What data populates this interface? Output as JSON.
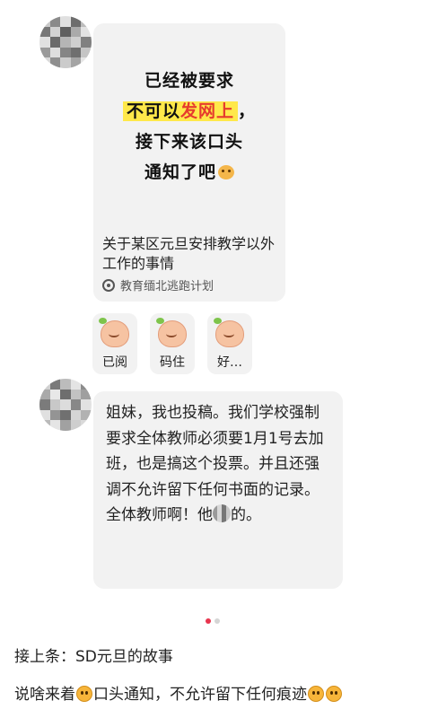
{
  "post_card": {
    "poster_lines": [
      "已经被要求",
      "不可以",
      "发网上",
      "，",
      "接下来该口头",
      "通知了吧"
    ],
    "title": "关于某区元旦安排教学以外工作的事情",
    "source": "教育缅北逃跑计划"
  },
  "reactions": [
    {
      "label": "已阅"
    },
    {
      "label": "码住"
    },
    {
      "label": "好…"
    }
  ],
  "message": {
    "text_before": "姐妹，我也投稿。我们学校强制要求全体教师必须要1月1号去加班，也是搞这个投票。并且还强调不允许留下任何书面的记录。全体教师啊！他",
    "text_after": "的。"
  },
  "pagination": {
    "current": 1,
    "total": 2
  },
  "caption": {
    "line1": "接上条：SD元旦的故事",
    "line2_a": "说啥来着",
    "line2_b": "口头通知，不允许留下任何痕迹"
  },
  "colors": {
    "highlight": "#ffe84a",
    "accent_red": "#e63b2e",
    "bubble_bg": "#f2f2f2",
    "active_dot": "#e8344e"
  },
  "icons": [
    "blurred-avatar",
    "source-icon",
    "peach-sticker",
    "smile-face-emoji"
  ]
}
